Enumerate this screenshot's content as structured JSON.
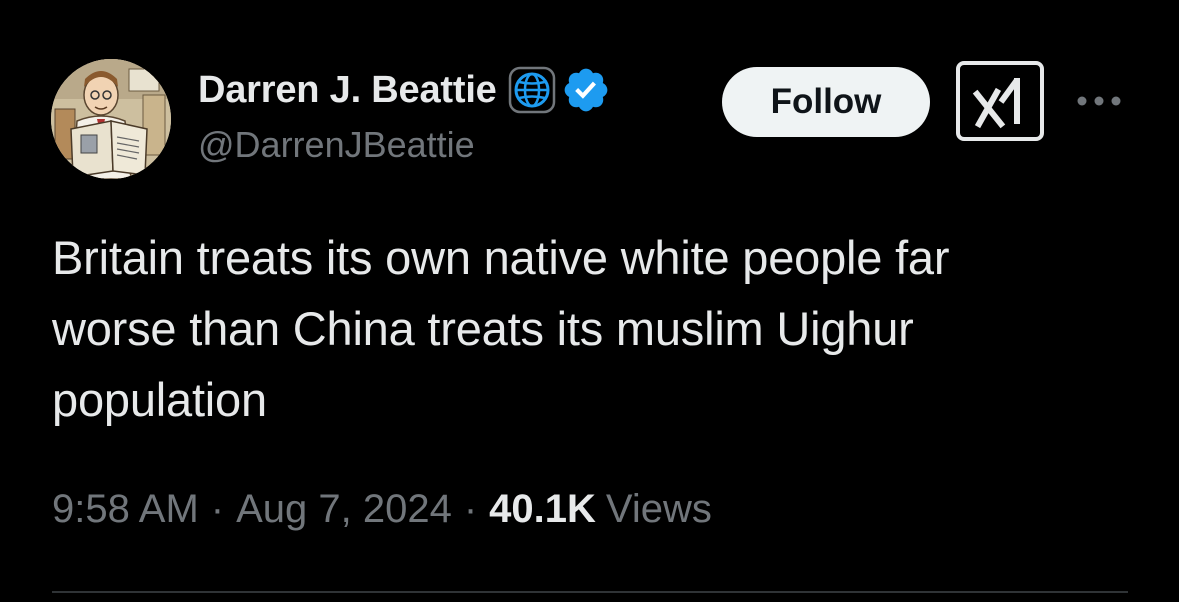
{
  "author": {
    "display_name": "Darren J. Beattie",
    "handle": "@DarrenJBeattie",
    "avatar_icon": "cartoon-portrait-avatar",
    "affiliation_icon": "globe-icon",
    "verified_icon": "verified-badge-icon",
    "verified_color": "#1d9bf0"
  },
  "actions": {
    "follow_label": "Follow",
    "grok_icon": "grok-icon",
    "more_icon": "more-options-icon"
  },
  "tweet": {
    "lines": [
      "Britain treats its own native white people far",
      "worse than China treats its muslim Uighur",
      "population"
    ]
  },
  "meta": {
    "time": "9:58 AM",
    "separator": "·",
    "date": "Aug 7, 2024",
    "views_count": "40.1K",
    "views_label": "Views"
  },
  "colors": {
    "background": "#000000",
    "text_primary": "#e7e9ea",
    "text_secondary": "#71767b",
    "follow_bg": "#eff3f4",
    "divider": "#2f3336"
  }
}
